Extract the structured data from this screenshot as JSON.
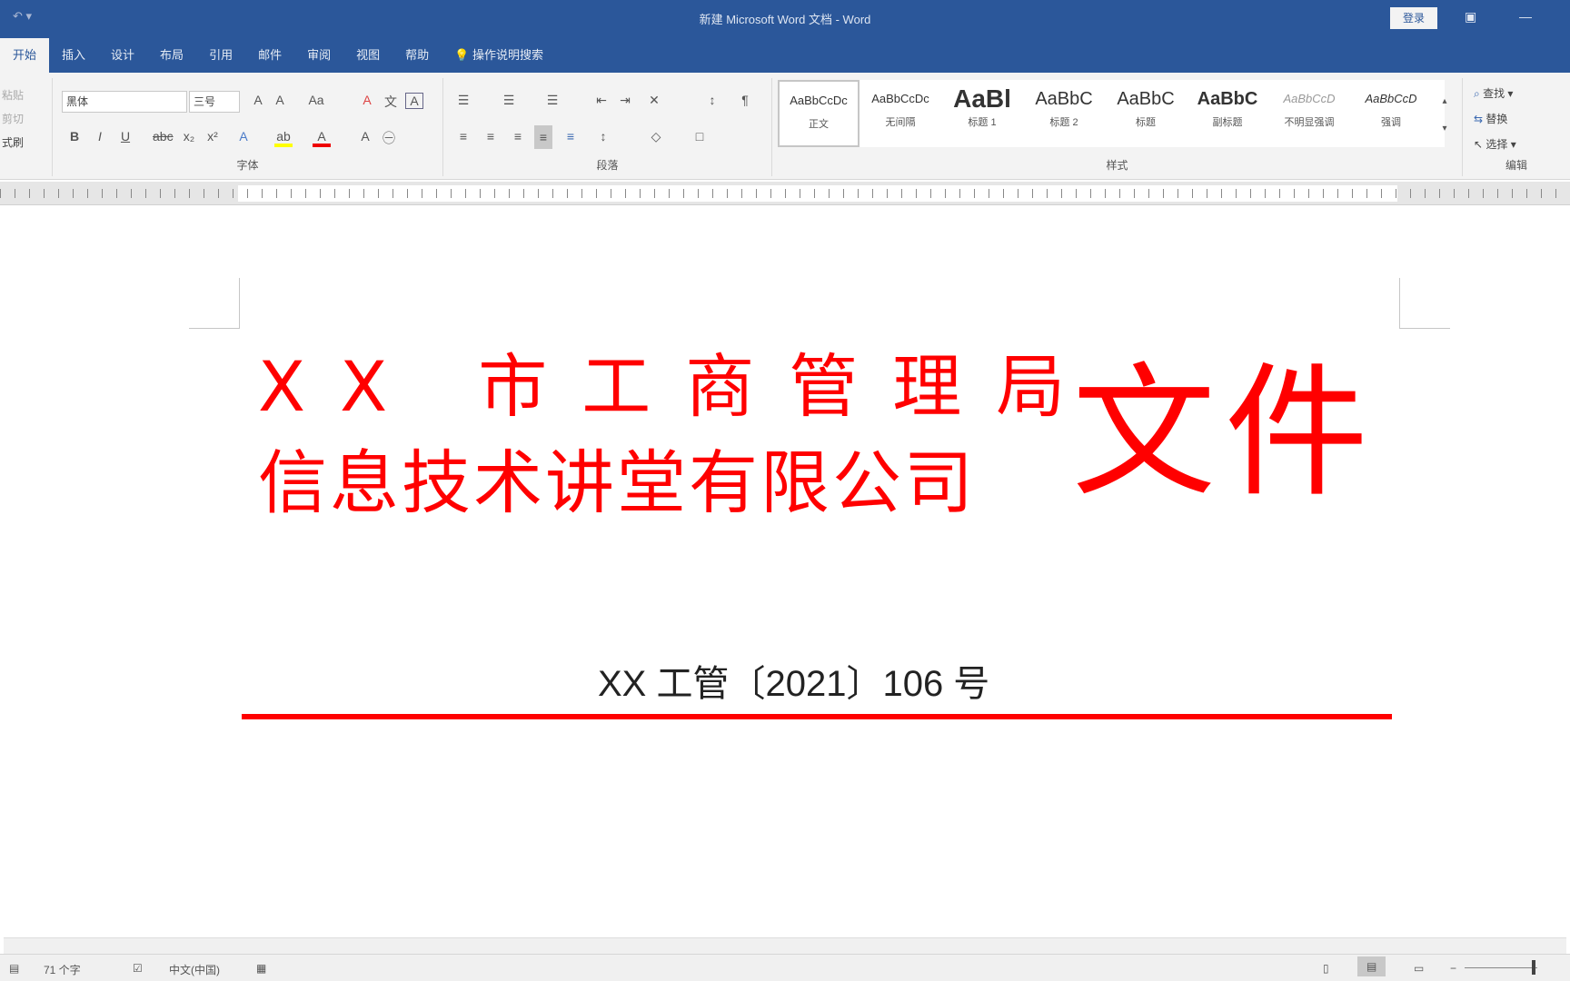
{
  "window": {
    "title": "新建 Microsoft Word 文档 - Word",
    "login": "登录",
    "quick_access": "↶ ▾"
  },
  "tabs": [
    "开始",
    "插入",
    "设计",
    "布局",
    "引用",
    "邮件",
    "审阅",
    "视图",
    "帮助"
  ],
  "tell_me": "操作说明搜索",
  "ribbon": {
    "clipboard": {
      "items": [
        "粘贴",
        "剪切",
        "式刷"
      ]
    },
    "font": {
      "name": "黑体",
      "size": "三号",
      "label": "字体"
    },
    "paragraph": {
      "label": "段落"
    },
    "styles": {
      "label": "样式",
      "items": [
        {
          "preview": "AaBbCcDc",
          "name": "正文"
        },
        {
          "preview": "AaBbCcDc",
          "name": "无间隔"
        },
        {
          "preview": "AaBl",
          "name": "标题 1"
        },
        {
          "preview": "AaBbC",
          "name": "标题 2"
        },
        {
          "preview": "AaBbC",
          "name": "标题"
        },
        {
          "preview": "AaBbC",
          "name": "副标题"
        },
        {
          "preview": "AaBbCcD",
          "name": "不明显强调"
        },
        {
          "preview": "AaBbCcD",
          "name": "强调"
        }
      ]
    },
    "editing": {
      "label": "编辑",
      "find": "查找",
      "replace": "替换",
      "select": "选择"
    }
  },
  "document": {
    "line1": "XX 市工商管理局",
    "line2": "信息技术讲堂有限公司",
    "suffix": "文件",
    "doc_number": "XX 工管〔2021〕106 号",
    "accent_color": "#ff0000"
  },
  "status": {
    "word_count": "71 个字",
    "language": "中文(中国)"
  }
}
